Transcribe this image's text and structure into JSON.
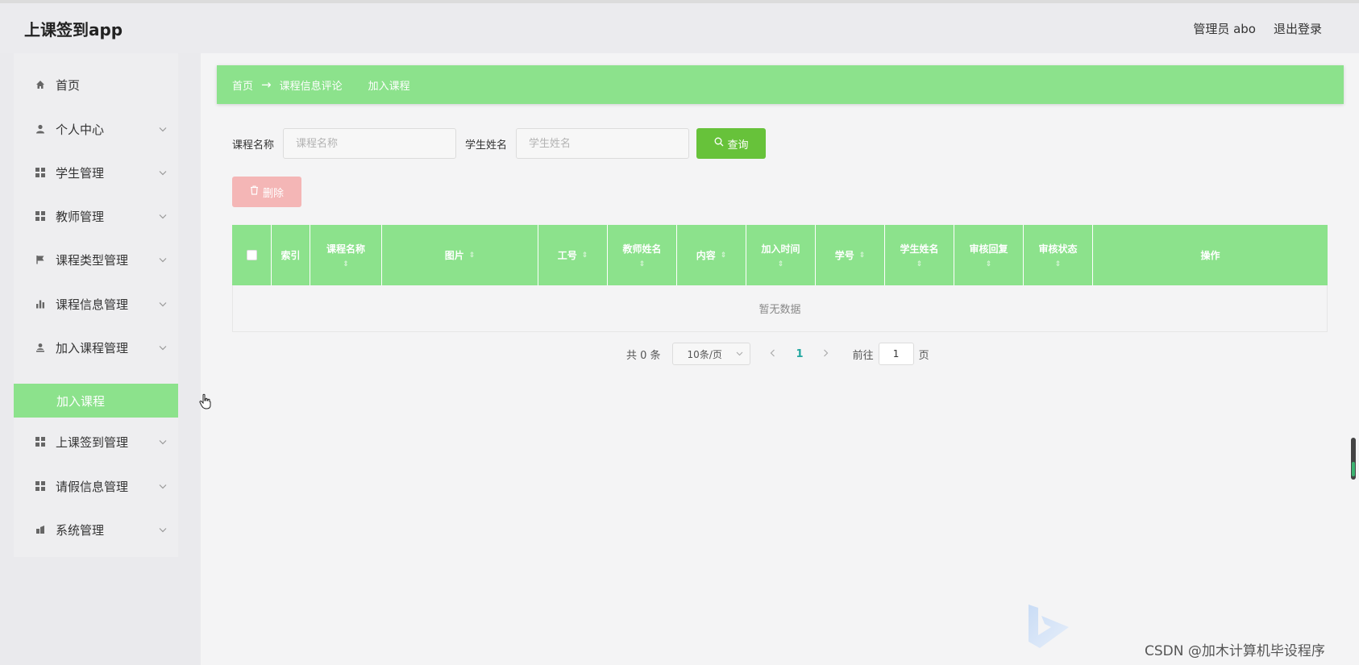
{
  "header": {
    "title": "上课签到app",
    "user": "管理员 abo",
    "logout": "退出登录"
  },
  "sidebar": {
    "items": [
      {
        "label": "首页"
      },
      {
        "label": "个人中心"
      },
      {
        "label": "学生管理"
      },
      {
        "label": "教师管理"
      },
      {
        "label": "课程类型管理"
      },
      {
        "label": "课程信息管理"
      },
      {
        "label": "加入课程管理"
      },
      {
        "label": "上课签到管理"
      },
      {
        "label": "请假信息管理"
      },
      {
        "label": "系统管理"
      }
    ],
    "active_sub": "加入课程"
  },
  "breadcrumb": {
    "home": "首页",
    "arrow": "→",
    "level1": "课程信息评论",
    "level2": "加入课程"
  },
  "search": {
    "course_label": "课程名称",
    "course_placeholder": "课程名称",
    "student_label": "学生姓名",
    "student_placeholder": "学生姓名",
    "query_button": "查询"
  },
  "actions": {
    "delete_button": "删除"
  },
  "table": {
    "columns": [
      "索引",
      "课程名称",
      "图片",
      "工号",
      "教师姓名",
      "内容",
      "加入时间",
      "学号",
      "学生姓名",
      "审核回复",
      "审核状态",
      "操作"
    ],
    "empty_text": "暂无数据"
  },
  "pagination": {
    "total": "共 0 条",
    "page_size": "10条/页",
    "current_page": "1",
    "goto_label": "前往",
    "goto_value": "1",
    "page_suffix": "页"
  },
  "watermark": "CSDN @加木计算机毕设程序",
  "colors": {
    "accent_green": "#8ce28c",
    "query_green": "#67c23a",
    "delete_pink": "#f4b6b6"
  }
}
